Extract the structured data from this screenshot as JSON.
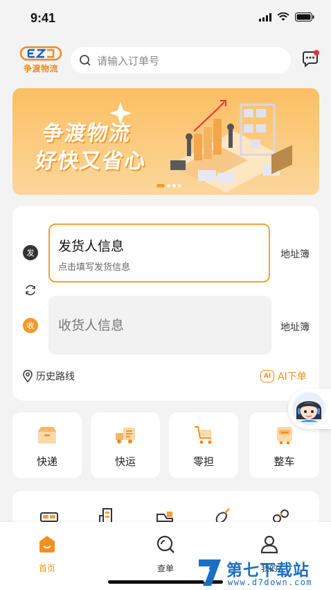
{
  "status_bar": {
    "time": "9:41"
  },
  "header": {
    "logo_text": "争渡物流",
    "search_placeholder": "请输入订单号"
  },
  "banner": {
    "line1": "争渡物流",
    "line2": "好快又省心"
  },
  "shipping": {
    "sender_badge": "发",
    "receiver_badge": "收",
    "sender_title": "发货人信息",
    "sender_subtitle": "点击填写发货信息",
    "receiver_title": "收货人信息",
    "address_book_label": "地址簿",
    "history_label": "历史路线",
    "ai_badge": "AI",
    "ai_order_label": "AI下单"
  },
  "services": [
    {
      "label": "快递",
      "icon": "box-icon"
    },
    {
      "label": "快运",
      "icon": "truck-icon"
    },
    {
      "label": "零担",
      "icon": "cart-icon"
    },
    {
      "label": "整车",
      "icon": "full-truck-icon"
    }
  ],
  "categories": [
    {
      "icon": "bed-icon"
    },
    {
      "icon": "building-icon"
    },
    {
      "icon": "forklift-icon"
    },
    {
      "icon": "eggplant-icon"
    },
    {
      "icon": "pipes-icon"
    }
  ],
  "tabs": [
    {
      "label": "首页",
      "icon": "home-icon",
      "active": true
    },
    {
      "label": "查单",
      "icon": "search-icon",
      "active": false
    },
    {
      "label": "我的",
      "icon": "user-icon",
      "active": false
    }
  ],
  "watermark": {
    "title": "第七下载站",
    "url": "www.d7down.com"
  },
  "colors": {
    "accent": "#f0901e",
    "background": "#f3f3f4",
    "watermark": "#1a6fc4"
  }
}
